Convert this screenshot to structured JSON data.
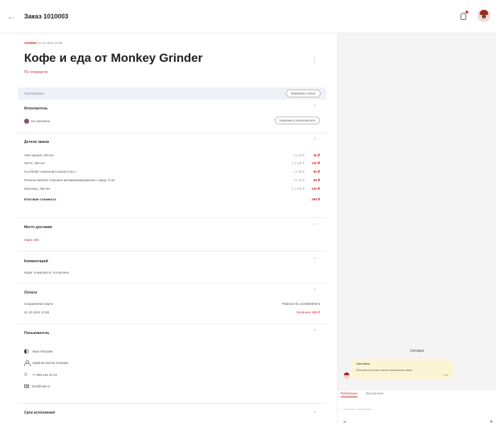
{
  "topbar": {
    "back_icon": "arrow-left-icon",
    "title": "Заказ 1010003"
  },
  "order": {
    "id": "1010003",
    "datetime": "21.10.2024 14:58",
    "title": "Кофе и еда от Monkey Grinder",
    "readiness": "По готовности",
    "status": "Подтвержден",
    "change_status_label": "Изменить статус"
  },
  "executor": {
    "heading": "Исполнитель",
    "value": "Не назначен",
    "assign_label": "Назначить исполнителя"
  },
  "details": {
    "heading": "Детали заказа",
    "items": [
      {
        "name": "Чай черный, 200 мл",
        "qty": "2 x 23 ₽",
        "price": "46 ₽"
      },
      {
        "name": "Латте, 300 мл",
        "qty": "1 x 130 ₽",
        "price": "130 ₽"
      },
      {
        "name": "Сок Rioba томатный в алюм 0,25 л",
        "qty": "1 x 65 ₽",
        "price": "55 ₽"
      },
      {
        "name": "Печенье BelVita Утреннее витаминизированное с какао, 5 шт",
        "qty": "2 x 34 ₽",
        "price": "68 ₽"
      },
      {
        "name": "Капучино, 300 мл",
        "qty": "1 x 100 ₽",
        "price": "100 ₽"
      }
    ],
    "total_label": "Итоговая стоимость",
    "total_value": "399 ₽"
  },
  "delivery": {
    "heading": "Место доставки",
    "value": "Офис 205"
  },
  "comment": {
    "heading": "Комментарий",
    "value": "Кофе, пожалуйста, погорячее!"
  },
  "payment": {
    "heading": "Оплата",
    "method": "Сохраненная карта",
    "card": "Platinum № 1234560000 5",
    "date": "21.10.2024 14:58",
    "paid": "Оплачено 399 ₽"
  },
  "user": {
    "heading": "Пользователь",
    "name": "Лера Петрова",
    "role": "Администратор локации",
    "phone": "+7 999 444 44 44",
    "email": "lera@mail.ru"
  },
  "deadline": {
    "heading": "Срок исполнения"
  },
  "chat": {
    "today_label": "Сегодня",
    "message": {
      "author": "Светлана",
      "text": "Поступила оплата через платёжный шлюз",
      "time": "14:58"
    },
    "tabs": [
      "Публичные",
      "Внутренние"
    ],
    "input_placeholder": "Написать сообщение..."
  },
  "colors": {
    "accent": "#d32b2b",
    "status_row": "#eef1f6",
    "chat_bg": "#f4f4f4",
    "bubble": "#fbf5d6"
  }
}
